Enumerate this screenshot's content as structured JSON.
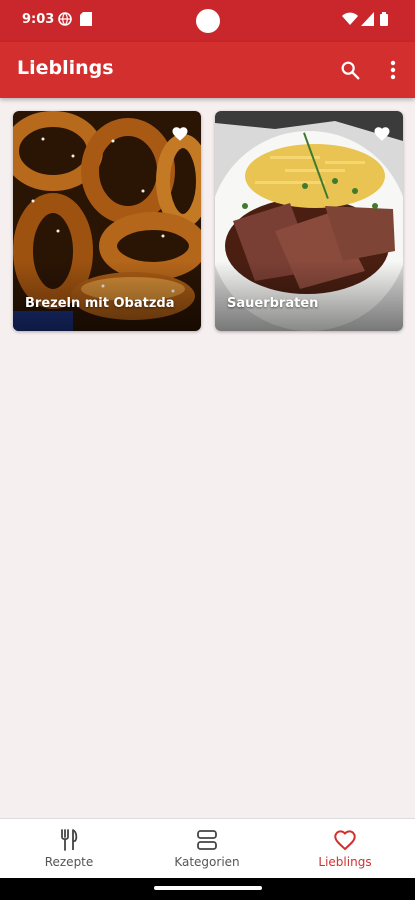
{
  "status_bar": {
    "time": "9:03",
    "icons": [
      "vpn-globe-icon",
      "sim-card-icon",
      "wifi-icon",
      "signal-icon",
      "battery-icon"
    ]
  },
  "app_bar": {
    "title": "Lieblings",
    "actions": [
      "search-icon",
      "more-vert-icon"
    ]
  },
  "favorites": [
    {
      "title": "Brezeln mit Obatzda",
      "image": "pretzels-photo",
      "favorite": true
    },
    {
      "title": "Sauerbraten",
      "image": "sauerbraten-photo",
      "favorite": true
    }
  ],
  "bottom_nav": {
    "items": [
      {
        "label": "Rezepte",
        "icon": "fork-knife-icon",
        "active": false
      },
      {
        "label": "Kategorien",
        "icon": "categories-icon",
        "active": false
      },
      {
        "label": "Lieblings",
        "icon": "heart-outline-icon",
        "active": true
      }
    ]
  },
  "colors": {
    "primary": "#d32f2f",
    "status_bar": "#c9272b",
    "background": "#f6efef",
    "nav_inactive": "#555555"
  }
}
